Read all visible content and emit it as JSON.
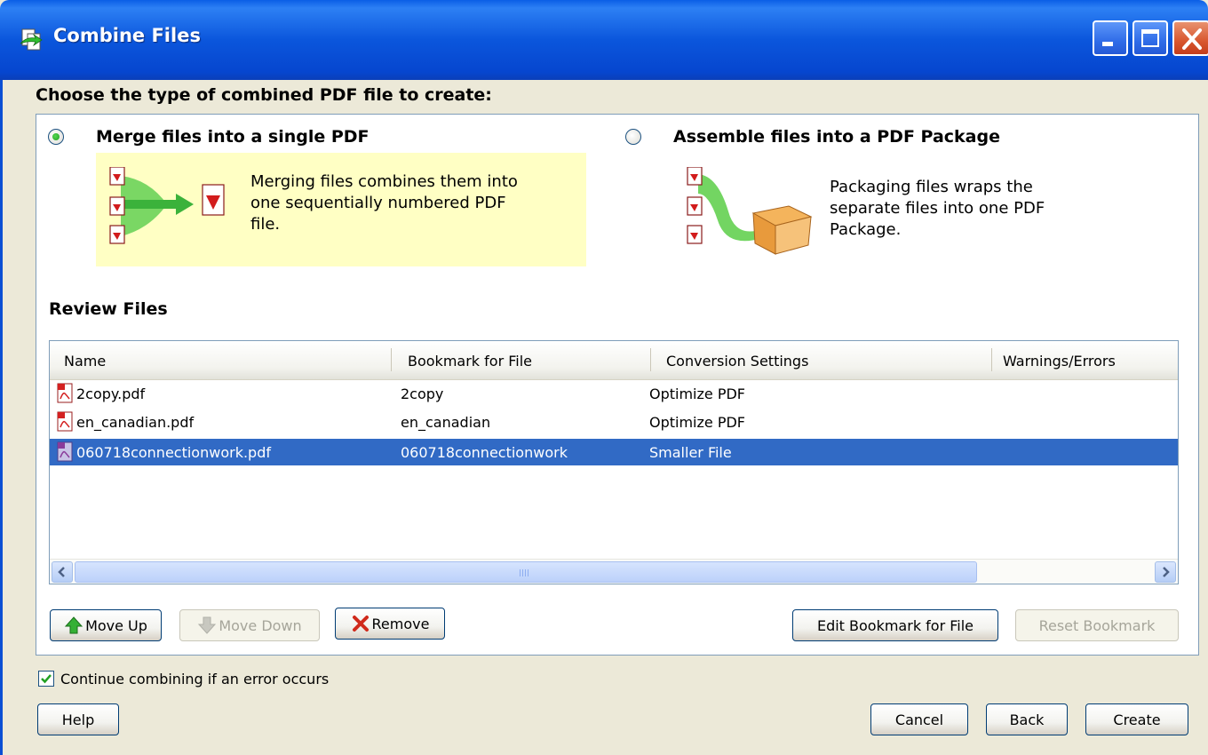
{
  "window": {
    "title": "Combine Files",
    "controls": {
      "minimize": "minimize-icon",
      "maximize": "maximize-icon",
      "close": "close-icon"
    }
  },
  "choose_type": {
    "heading": "Choose the type of combined PDF file to create:",
    "options": [
      {
        "label": "Merge files into a single PDF",
        "selected": true,
        "description": [
          "Merging files combines them into",
          "one sequentially numbered PDF",
          "file."
        ]
      },
      {
        "label": "Assemble files into a PDF Package",
        "selected": false,
        "description": [
          "Packaging files wraps the",
          "separate files into one PDF",
          "Package."
        ]
      }
    ]
  },
  "review": {
    "heading": "Review Files",
    "columns": [
      "Name",
      "Bookmark for File",
      "Conversion Settings",
      "Warnings/Errors"
    ],
    "rows": [
      {
        "name": "2copy.pdf",
        "bookmark": "2copy",
        "settings": "Optimize PDF",
        "warnings": "",
        "icon": "pdf-file-icon",
        "selected": false
      },
      {
        "name": "en_canadian.pdf",
        "bookmark": "en_canadian",
        "settings": "Optimize PDF",
        "warnings": "",
        "icon": "pdf-file-icon",
        "selected": false
      },
      {
        "name": "060718connectionwork.pdf",
        "bookmark": "060718connectionwork",
        "settings": "Smaller File",
        "warnings": "",
        "icon": "pdf-file-icon",
        "selected": true
      }
    ]
  },
  "buttons": {
    "move_up": "Move Up",
    "move_down": "Move Down",
    "remove": "Remove",
    "edit_bookmark": "Edit Bookmark for File",
    "reset_bookmark": "Reset Bookmark",
    "help": "Help",
    "cancel": "Cancel",
    "back": "Back",
    "create": "Create"
  },
  "options": {
    "continue_on_error": {
      "label": "Continue combining if an error occurs",
      "checked": true
    }
  },
  "colors": {
    "titlebar": "#0b56dc",
    "selection": "#316ac5",
    "merge_panel": "#ffffc4",
    "dialog_bg": "#ece9d8"
  }
}
